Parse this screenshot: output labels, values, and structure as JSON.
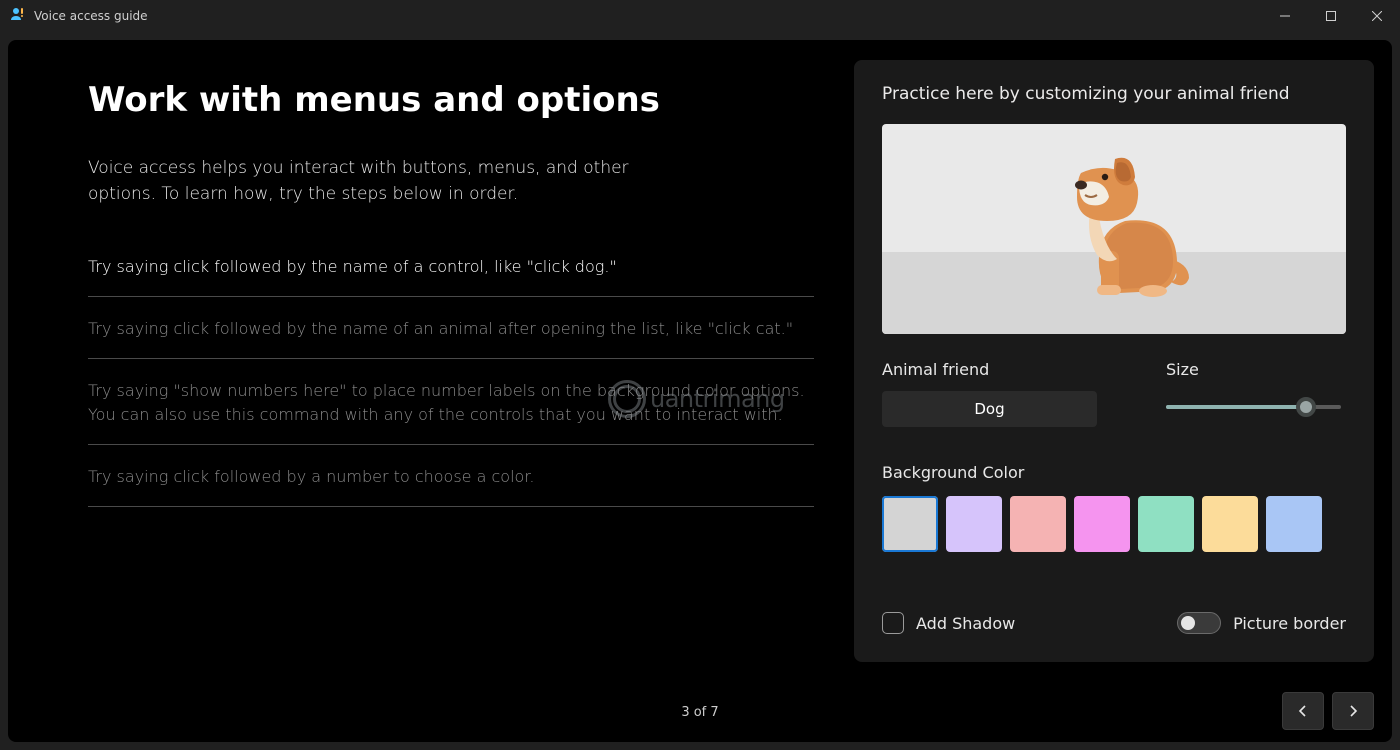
{
  "window": {
    "title": "Voice access guide"
  },
  "page": {
    "title": "Work with menus and options",
    "intro": "Voice access helps you interact with buttons, menus, and other options. To learn how, try the steps below in order.",
    "steps": [
      {
        "text": "Try saying click followed by the name of a control, like \"click dog.\"",
        "active": true
      },
      {
        "text": "Try saying click followed by the name of an animal after opening the list, like \"click cat.\"",
        "active": false
      },
      {
        "text": "Try saying \"show numbers here\" to place number labels on the background color options. You can also use this command with any of the controls that you want to interact with.",
        "active": false
      },
      {
        "text": "Try saying click followed by a number to choose a color.",
        "active": false
      }
    ],
    "pager": "3 of 7"
  },
  "practice": {
    "heading": "Practice here by customizing your animal friend",
    "animal_friend_label": "Animal friend",
    "animal_friend_value": "Dog",
    "size_label": "Size",
    "size_percent": 80,
    "bg_label": "Background Color",
    "colors": [
      {
        "hex": "#d4d4d4",
        "selected": true
      },
      {
        "hex": "#d6c4fb",
        "selected": false
      },
      {
        "hex": "#f5b3b3",
        "selected": false
      },
      {
        "hex": "#f594ef",
        "selected": false
      },
      {
        "hex": "#8fe0c2",
        "selected": false
      },
      {
        "hex": "#fcdc9a",
        "selected": false
      },
      {
        "hex": "#a9c6f5",
        "selected": false
      }
    ],
    "add_shadow_label": "Add Shadow",
    "add_shadow_checked": false,
    "picture_border_label": "Picture border",
    "picture_border_on": false
  },
  "watermark": "uantrimang"
}
